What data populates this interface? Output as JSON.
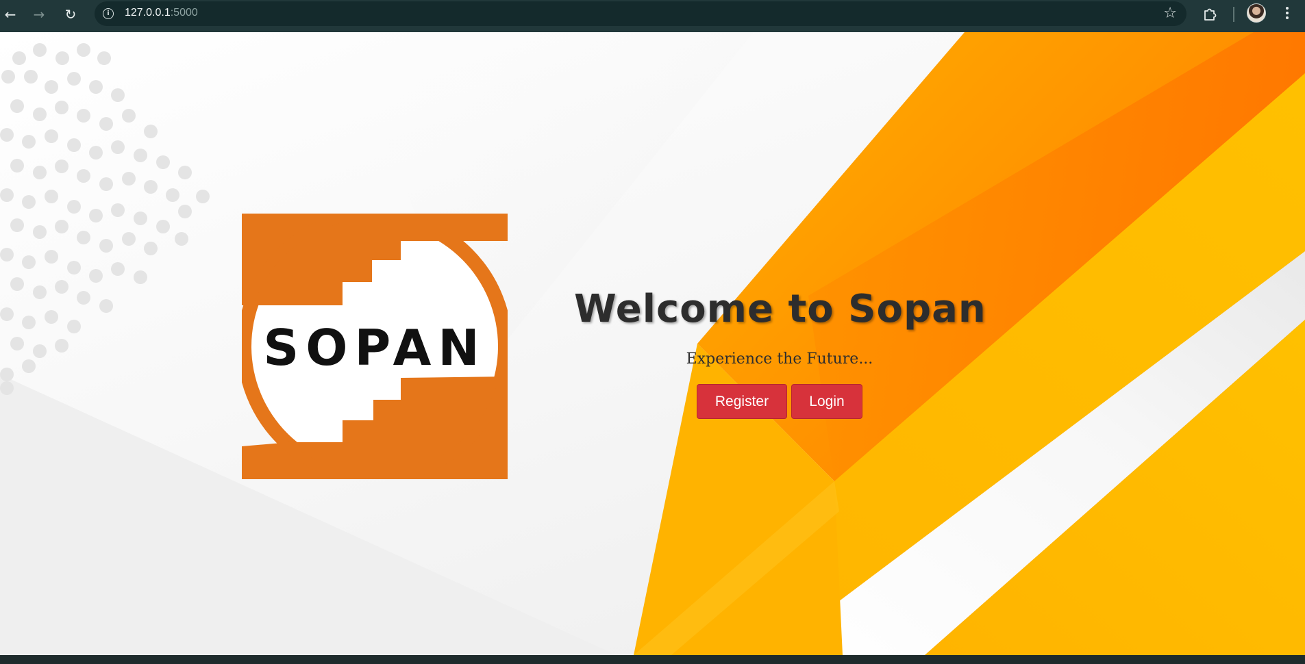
{
  "browser": {
    "url_host": "127.0.0.1",
    "url_port": ":5000",
    "icons": {
      "back": "arrow-left-icon",
      "forward": "arrow-right-icon",
      "reload": "reload-icon",
      "site_info": "info-icon",
      "bookmark": "star-icon",
      "extensions": "puzzle-icon",
      "profile": "avatar",
      "menu": "kebab-menu-icon"
    },
    "colors": {
      "toolbar": "#21383a",
      "omnibox": "#142a2c"
    }
  },
  "logo": {
    "text": "SOPAN",
    "ring_color": "#e5761a"
  },
  "hero": {
    "title": "Welcome to Sopan",
    "subtitle": "Experience the Future...",
    "buttons": {
      "register": "Register",
      "login": "Login"
    },
    "button_color": "#d7323b"
  },
  "theme": {
    "accent_orange": "#ff8a00",
    "accent_yellow": "#ffb800"
  }
}
